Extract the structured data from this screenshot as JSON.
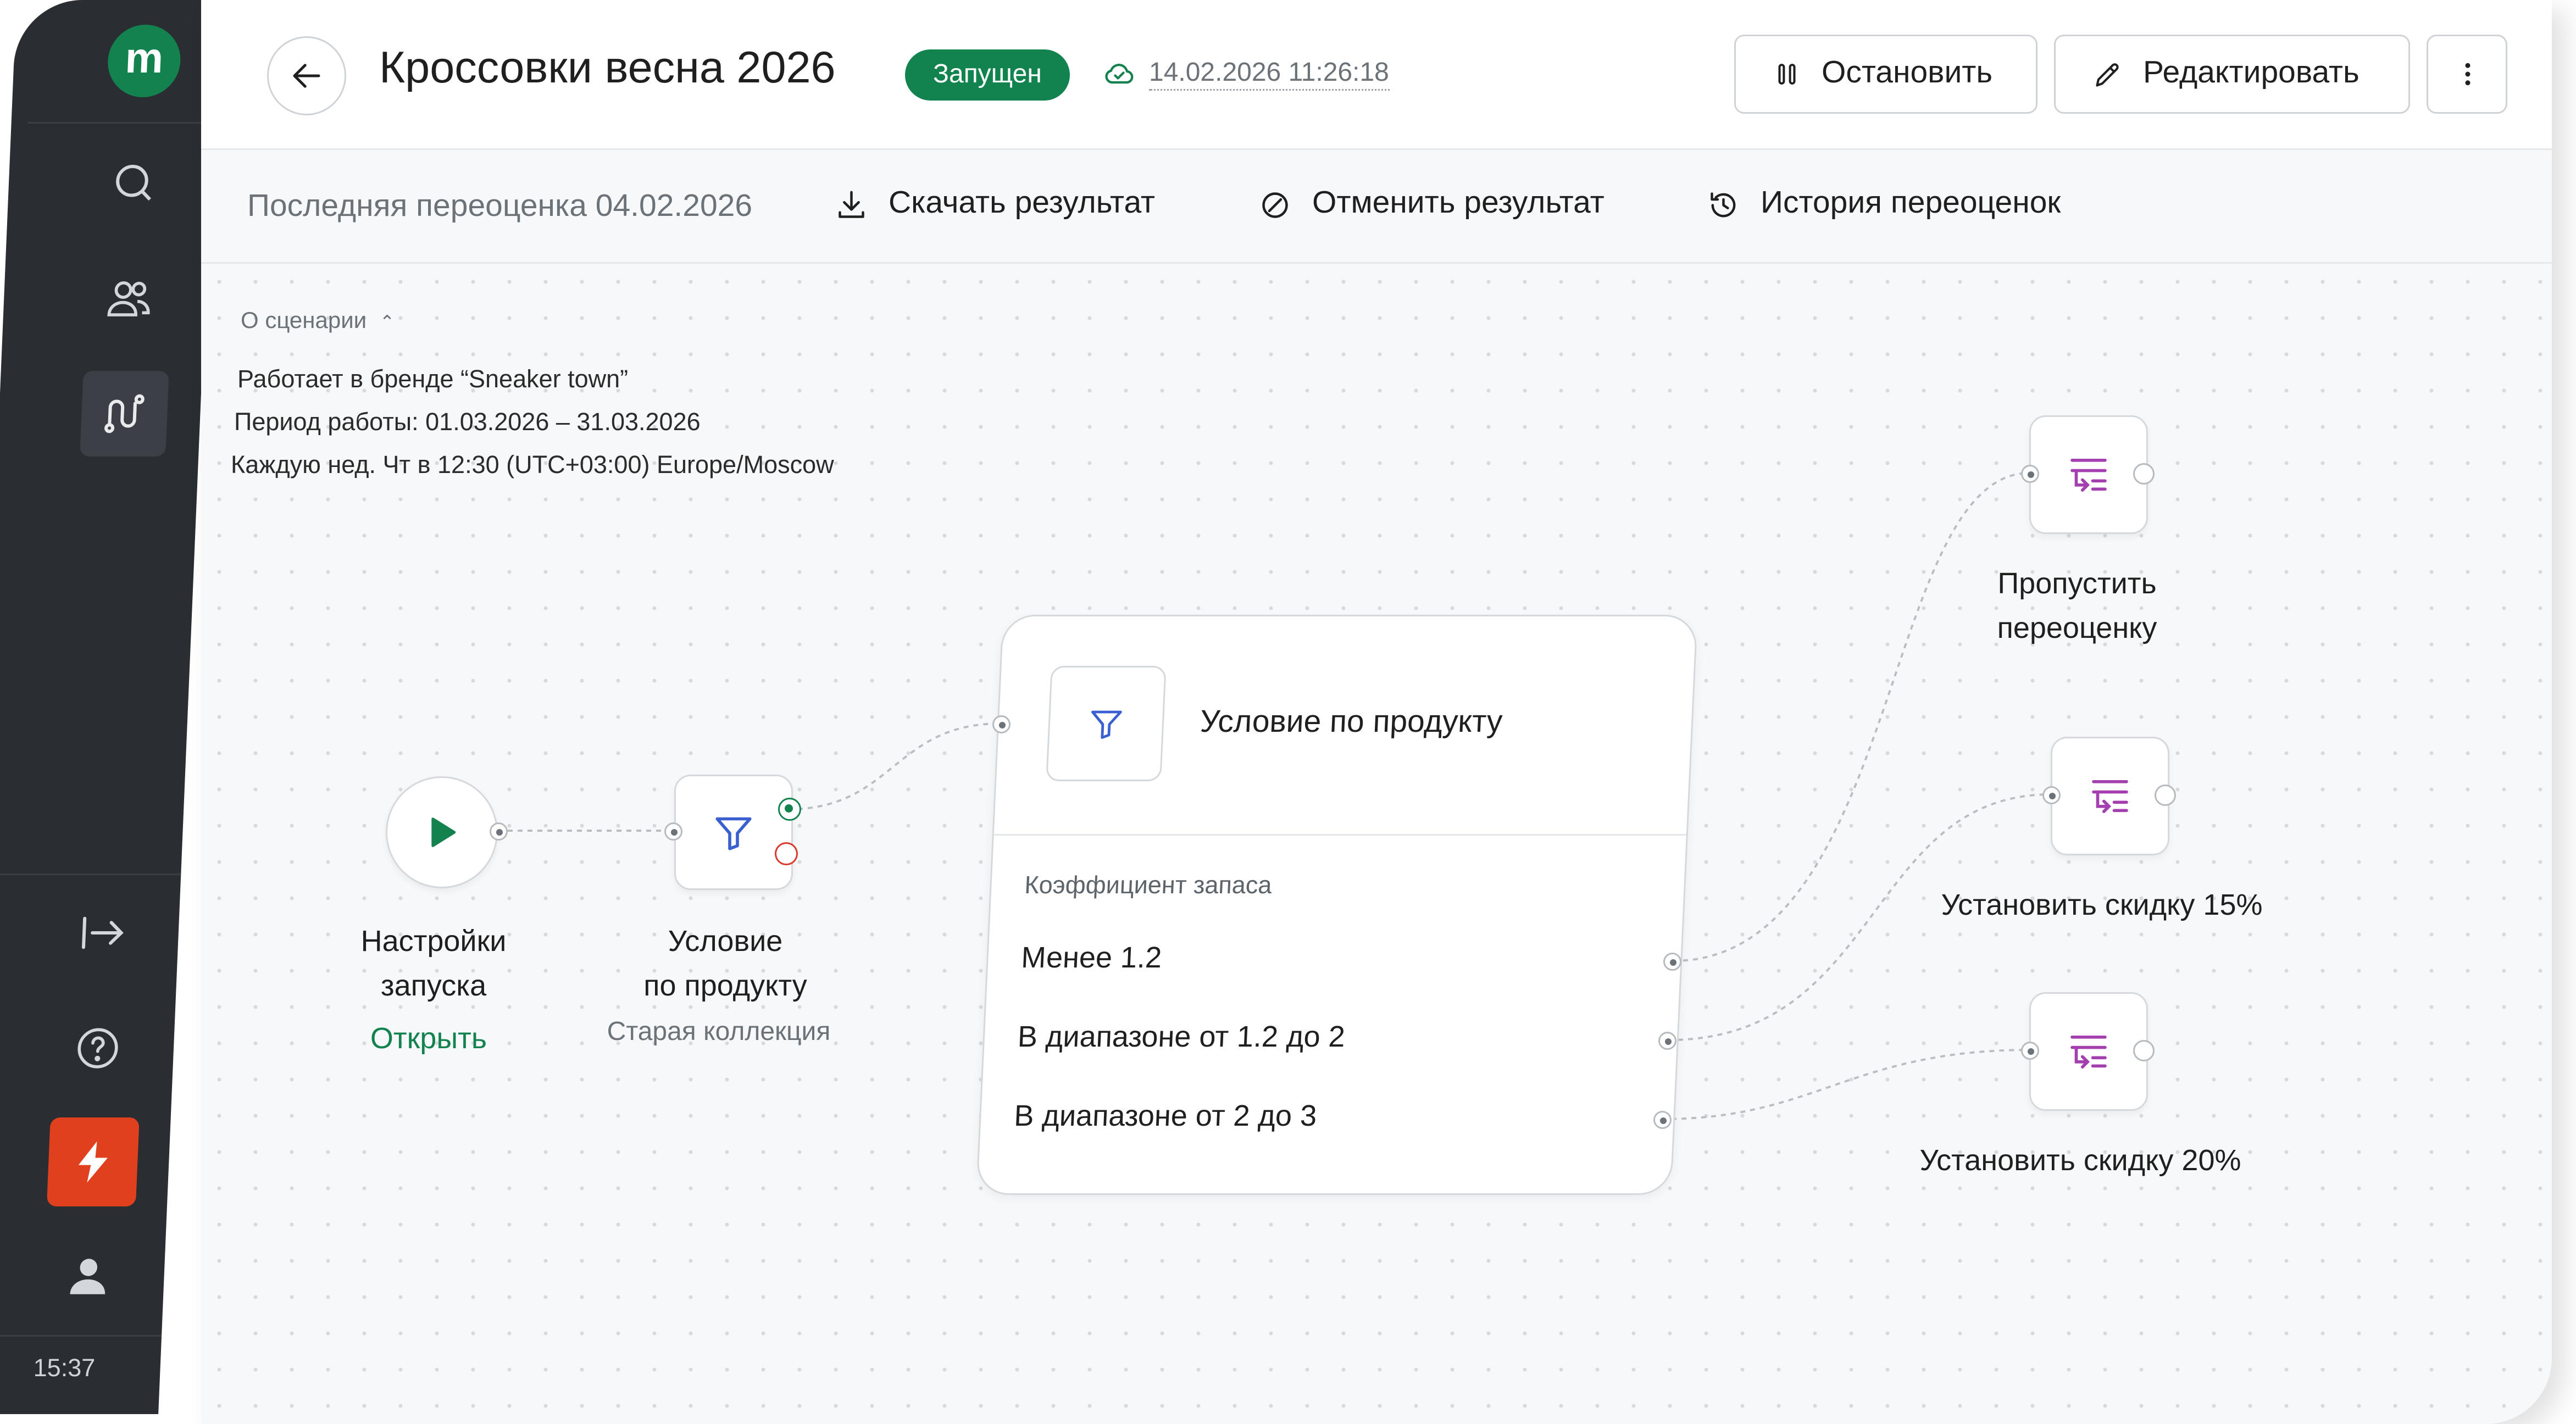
{
  "sidebar": {
    "logo_letter": "m",
    "time": "15:37",
    "items": [
      {
        "icon": "search-icon"
      },
      {
        "icon": "users-icon"
      },
      {
        "icon": "scenarios-icon"
      },
      {
        "icon": "logout-icon"
      },
      {
        "icon": "help-icon"
      },
      {
        "icon": "lightning-icon"
      },
      {
        "icon": "profile-icon"
      }
    ]
  },
  "header": {
    "title": "Кроссовки весна 2026",
    "status": "Запущен",
    "sync_time": "14.02.2026 11:26:18",
    "stop_label": "Остановить",
    "edit_label": "Редактировать"
  },
  "toolbar": {
    "last_repricing": "Последняя переоценка 04.02.2026",
    "download_label": "Скачать результат",
    "cancel_label": "Отменить результат",
    "history_label": "История переоценок"
  },
  "about": {
    "toggle_label": "О сценарии",
    "lines": [
      "Работает в бренде “Sneaker town”",
      "Период работы: 01.03.2026 – 31.03.2026",
      "Каждую нед. Чт в 12:30 (UTC+03:00) Europe/Moscow"
    ]
  },
  "flow": {
    "start": {
      "label_1": "Настройки",
      "label_2": "запуска",
      "link": "Открыть"
    },
    "filter": {
      "label_1": "Условие",
      "label_2": "по продукту",
      "sub": "Старая коллекция"
    },
    "condition": {
      "title": "Условие по продукту",
      "group": "Коэффициент запаса",
      "rows": [
        "Менее 1.2",
        "В диапазоне от 1.2 до 2",
        "В диапазоне от 2 до 3"
      ]
    },
    "actions": [
      {
        "label_1": "Пропустить",
        "label_2": "переоценку"
      },
      {
        "label_1": "Установить скидку 15%"
      },
      {
        "label_1": "Установить скидку 20%"
      }
    ]
  },
  "colors": {
    "brand_green": "#13824f",
    "danger_red": "#d93a2b",
    "accent_orange": "#e0401e",
    "action_purple": "#a43fb0",
    "filter_blue": "#3a5fd0"
  }
}
